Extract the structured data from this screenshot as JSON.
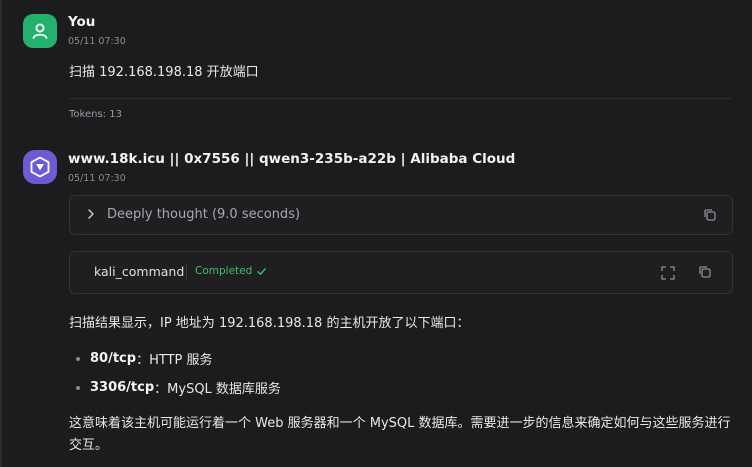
{
  "user_msg": {
    "author": "You",
    "time": "05/11 07:30",
    "text": "扫描 192.168.198.18 开放端口",
    "tokens": "Tokens: 13"
  },
  "bot_msg": {
    "author": "www.18k.icu || 0x7556 || qwen3-235b-a22b | Alibaba Cloud",
    "time": "05/11 07:30",
    "thought_label": "Deeply thought (9.0 seconds)",
    "tool": {
      "name": "kali_command",
      "status": "Completed"
    },
    "intro": "扫描结果显示，IP 地址为 192.168.198.18 的主机开放了以下端口：",
    "ports": [
      {
        "port": "80/tcp",
        "desc": "：HTTP 服务"
      },
      {
        "port": "3306/tcp",
        "desc": "：MySQL 数据库服务"
      }
    ],
    "closing": "这意味着该主机可能运行着一个 Web 服务器和一个 MySQL 数据库。需要进一步的信息来确定如何与这些服务进行交互。"
  },
  "colors": {
    "background": "#1c1c1e",
    "user_avatar": "#23b26d",
    "bot_avatar": "#6b5cd6",
    "status_green": "#3fbf6a"
  },
  "icons": {
    "user_avatar": "person-icon",
    "bot_avatar": "qwen-logo-icon",
    "thought_toggle": "chevron-right-icon",
    "copy": "copy-icon",
    "expand": "expand-icon",
    "status": "check-icon"
  }
}
